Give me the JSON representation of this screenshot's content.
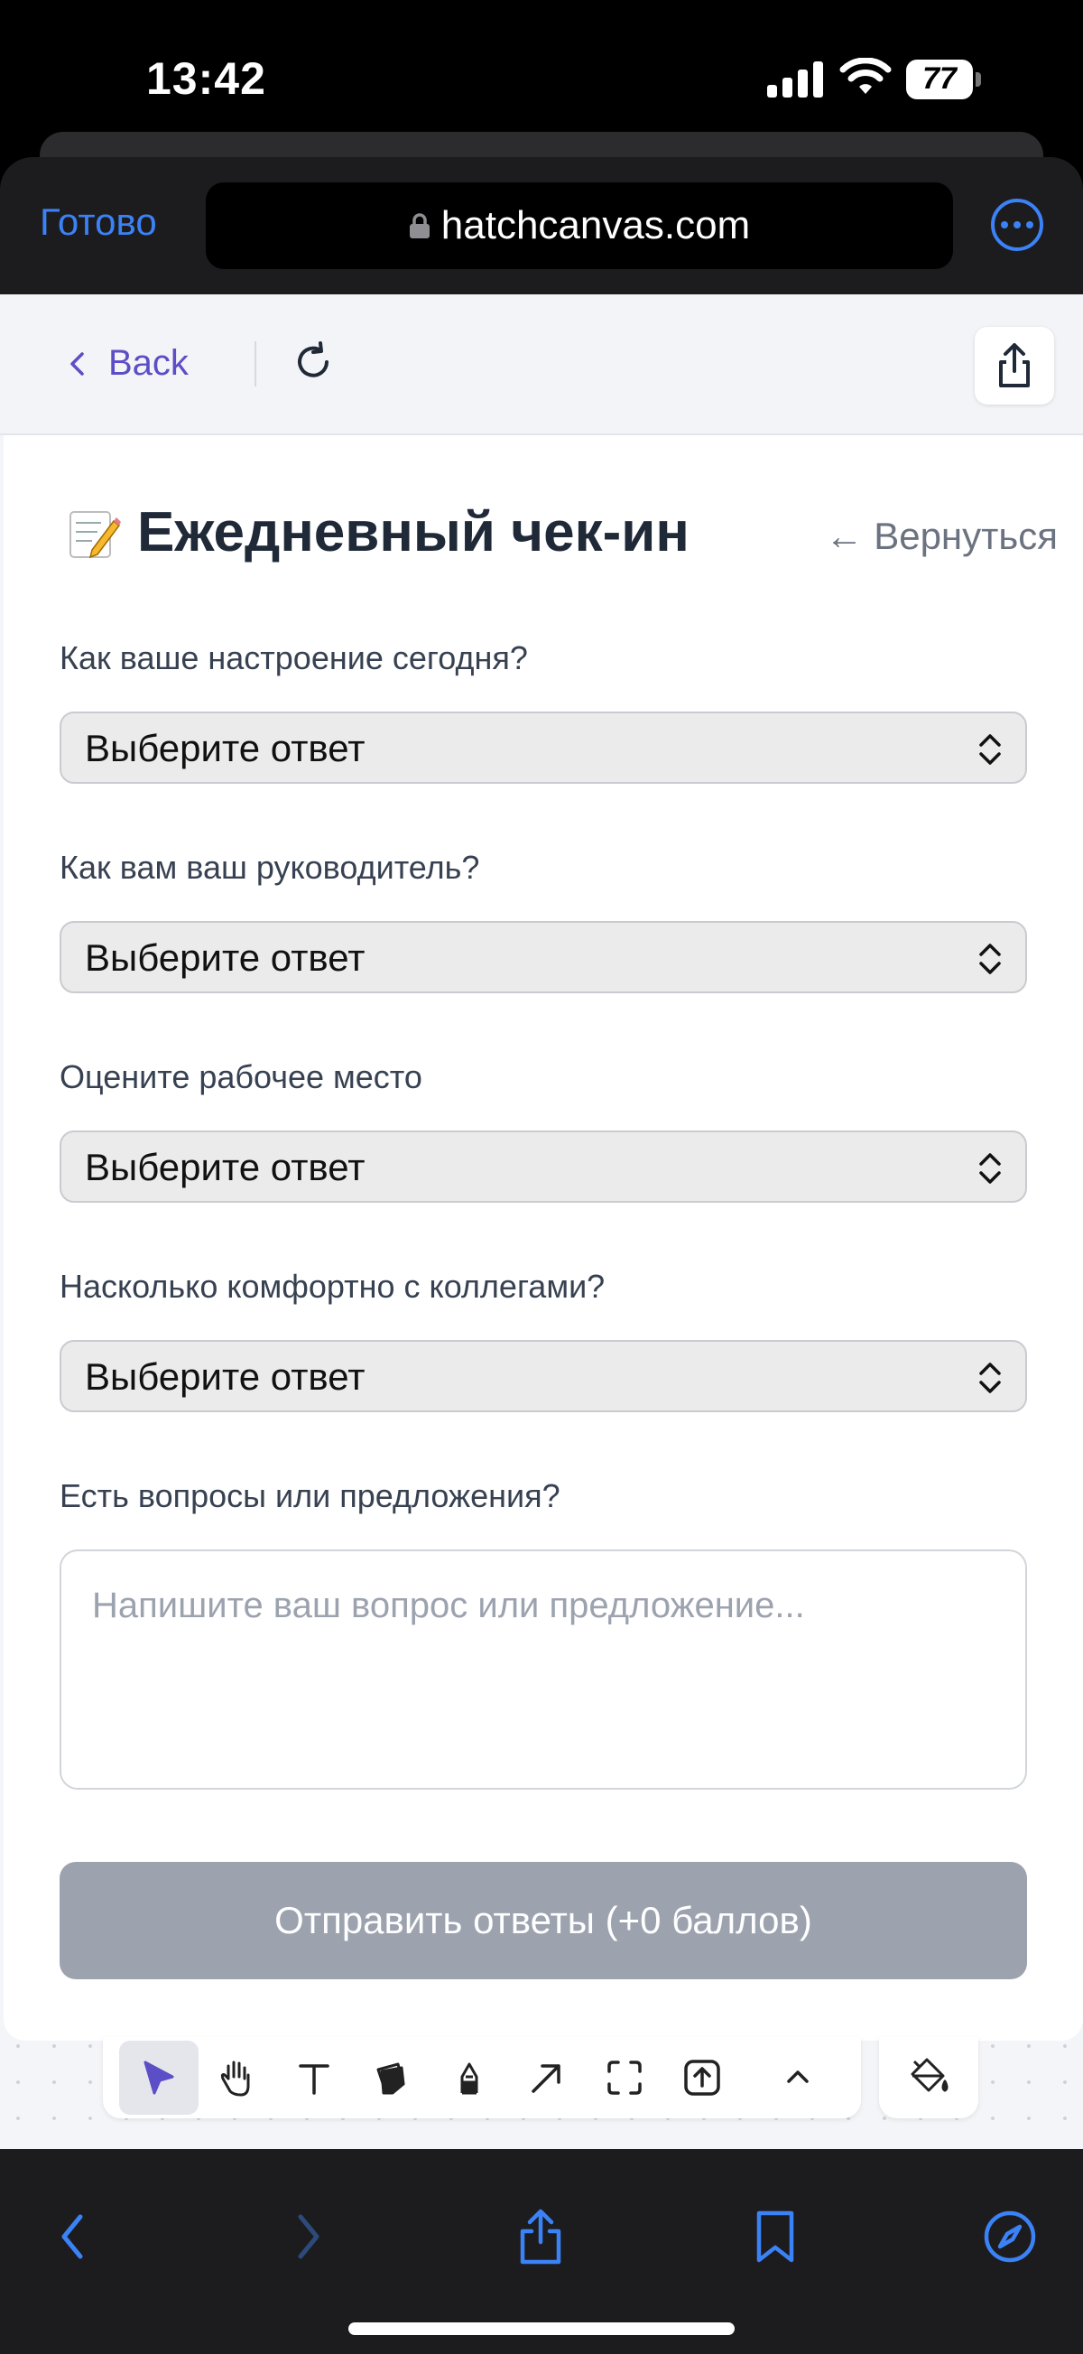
{
  "status_bar": {
    "time": "13:42",
    "battery": "77"
  },
  "browser": {
    "done_label": "Готово",
    "url": "hatchcanvas.com"
  },
  "app_header": {
    "back_label": "Back"
  },
  "form": {
    "title": "Ежедневный чек-ин",
    "return_label": "← Вернуться",
    "questions": [
      {
        "label": "Как ваше настроение сегодня?",
        "value": "Выберите ответ"
      },
      {
        "label": "Как вам ваш руководитель?",
        "value": "Выберите ответ"
      },
      {
        "label": "Оцените рабочее место",
        "value": "Выберите ответ"
      },
      {
        "label": "Насколько комфортно с коллегами?",
        "value": "Выберите ответ"
      }
    ],
    "comment_label": "Есть вопросы или предложения?",
    "comment_placeholder": "Напишите ваш вопрос или предложение...",
    "submit_label": "Отправить ответы (+0 баллов)"
  },
  "toolbar": {
    "tools": [
      "select-pointer-icon",
      "hand-icon",
      "text-icon",
      "sticky-note-icon",
      "pen-icon",
      "arrow-icon",
      "frame-icon",
      "upload-icon",
      "chevron-up-icon"
    ],
    "active_tool": "select-pointer-icon"
  },
  "colors": {
    "accent": "#3b82f6",
    "brand_purple": "#5b4ec7",
    "submit_disabled": "#9ca3af"
  }
}
